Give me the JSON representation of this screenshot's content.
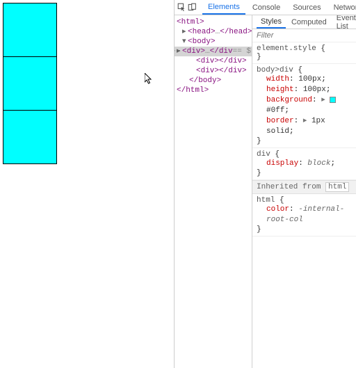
{
  "viewport": {
    "box_count": 3
  },
  "tabs": {
    "elements": "Elements",
    "console": "Console",
    "sources": "Sources",
    "network": "Network"
  },
  "dom": {
    "l0": "<html>",
    "l1_open": "<head>",
    "l1_close": "</head>",
    "l2_open": "<body>",
    "l3_open": "<div>",
    "l3_mid": "…",
    "l3_close": "</div>",
    "l4_open": "<div>",
    "l4_close": "</div>",
    "l5_open": "<div>",
    "l5_close": "</div>",
    "l6": "</body>",
    "l7": "</html>"
  },
  "subtabs": {
    "styles": "Styles",
    "computed": "Computed",
    "event": "Event List"
  },
  "filter": {
    "placeholder": "Filter"
  },
  "rules": {
    "elstyle": {
      "selector": "element.style",
      "open": " {",
      "close": "}"
    },
    "r1": {
      "selector": "body>div",
      "open": " {",
      "d1p": "width",
      "d1v": "100px",
      "d2p": "height",
      "d2v": "100px",
      "d3p": "background",
      "d3v": "#0ff",
      "d4p": "border",
      "d4v": "1px solid",
      "close": "}"
    },
    "r2": {
      "selector": "div",
      "open": " {",
      "d1p": "display",
      "d1v": "block",
      "close": "}"
    },
    "inherited_label": "Inherited from",
    "inherited_src": "html",
    "r3": {
      "selector": "html",
      "open": " {",
      "d1p": "color",
      "d1v": "-internal-root-col",
      "close": "}"
    },
    "colon": ": ",
    "semi": ";",
    "disc": "▸ "
  }
}
